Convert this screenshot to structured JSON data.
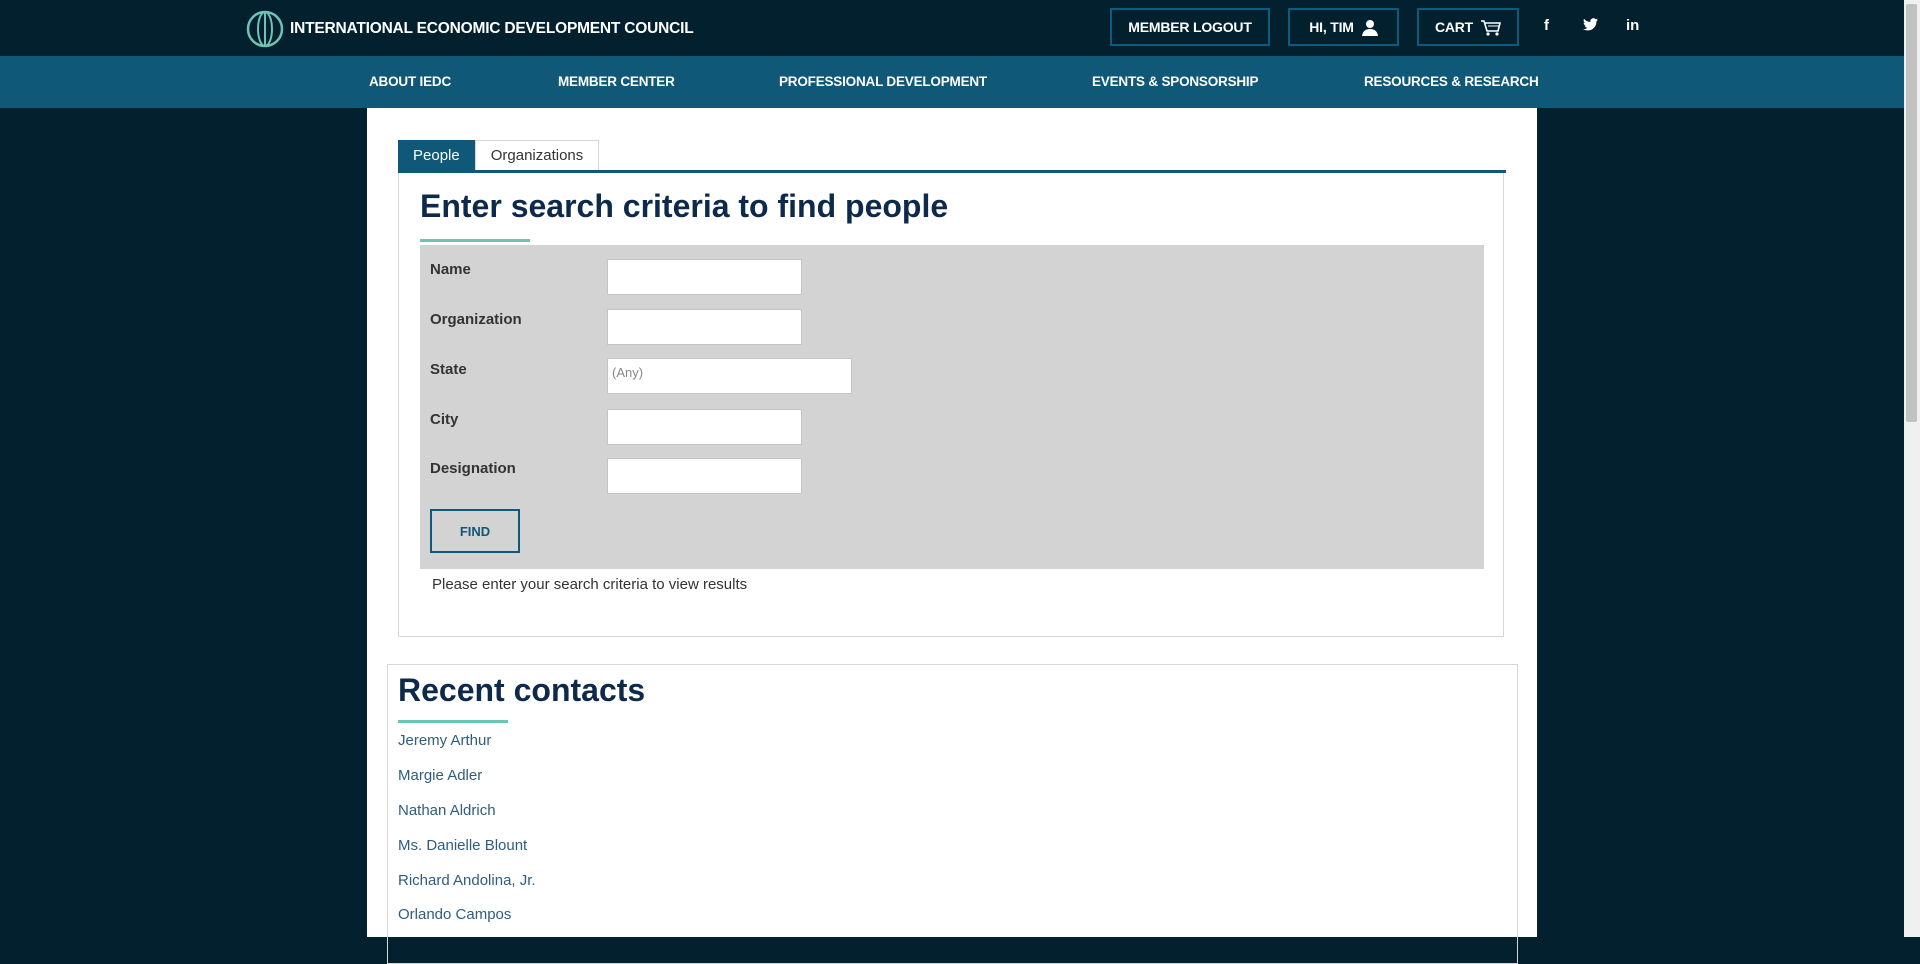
{
  "header": {
    "logo_text": "INTERNATIONAL ECONOMIC DEVELOPMENT COUNCIL",
    "logout_label": "MEMBER LOGOUT",
    "user_label": "HI, TIM",
    "cart_label": "CART",
    "social": {
      "facebook": "f",
      "twitter": "twitter-icon",
      "linkedin": "in"
    }
  },
  "nav": [
    "ABOUT IEDC",
    "MEMBER CENTER",
    "PROFESSIONAL DEVELOPMENT",
    "EVENTS & SPONSORSHIP",
    "RESOURCES & RESEARCH"
  ],
  "tabs": {
    "people": "People",
    "organizations": "Organizations"
  },
  "search": {
    "heading": "Enter search criteria to find people",
    "fields": {
      "name": "Name",
      "organization": "Organization",
      "state": "State",
      "city": "City",
      "designation": "Designation"
    },
    "state_value": "(Any)",
    "find_label": "FIND",
    "hint": "Please enter your search criteria to view results"
  },
  "recent": {
    "heading": "Recent contacts",
    "contacts": [
      "Jeremy Arthur",
      "Margie Adler",
      "Nathan Aldrich",
      "Ms. Danielle Blount",
      "Richard Andolina, Jr.",
      "Orlando Campos"
    ]
  },
  "colors": {
    "background": "#03202f",
    "nav": "#0f5878",
    "accent": "#6fc3b2",
    "heading": "#0d2a4a"
  }
}
